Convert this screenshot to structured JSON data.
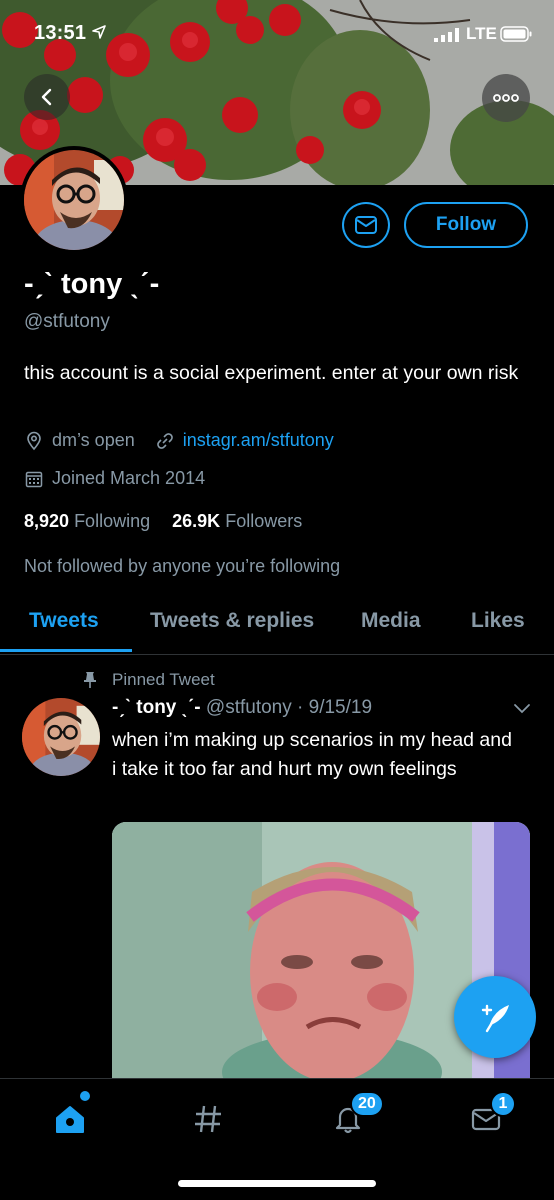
{
  "status_bar": {
    "time": "13:51",
    "carrier": "LTE"
  },
  "profile": {
    "display_name": "-ˏˋ tony ˎˊ-",
    "handle": "@stfutony",
    "bio": "this account is a social experiment. enter at your own risk",
    "location": "dm’s open",
    "website": "instagr.am/stfutony",
    "joined": "Joined March 2014",
    "following_count": "8,920",
    "following_label": "Following",
    "followers_count": "26.9K",
    "followers_label": "Followers",
    "followed_by": "Not followed by anyone you’re following",
    "follow_label": "Follow"
  },
  "tabs": [
    {
      "label": "Tweets",
      "active": true
    },
    {
      "label": "Tweets & replies",
      "active": false
    },
    {
      "label": "Media",
      "active": false
    },
    {
      "label": "Likes",
      "active": false
    }
  ],
  "pinned_tweet": {
    "pinned_label": "Pinned Tweet",
    "name": "-ˏˋ tony ˎˊ-",
    "handle_date": "@stfutony · 9/15/19",
    "text": "when i’m making up scenarios in my head and i take it too far and hurt my own feelings"
  },
  "bottom_nav": {
    "notifications_badge": "20",
    "messages_badge": "1"
  },
  "colors": {
    "accent": "#1da1f2",
    "secondary_text": "#8899a6",
    "background": "#000000"
  },
  "icons": [
    "back-icon",
    "more-icon",
    "mail-icon",
    "location-icon",
    "link-icon",
    "calendar-icon",
    "pin-icon",
    "chevron-down-icon",
    "compose-icon",
    "home-icon",
    "hashtag-icon",
    "bell-icon",
    "envelope-icon"
  ]
}
